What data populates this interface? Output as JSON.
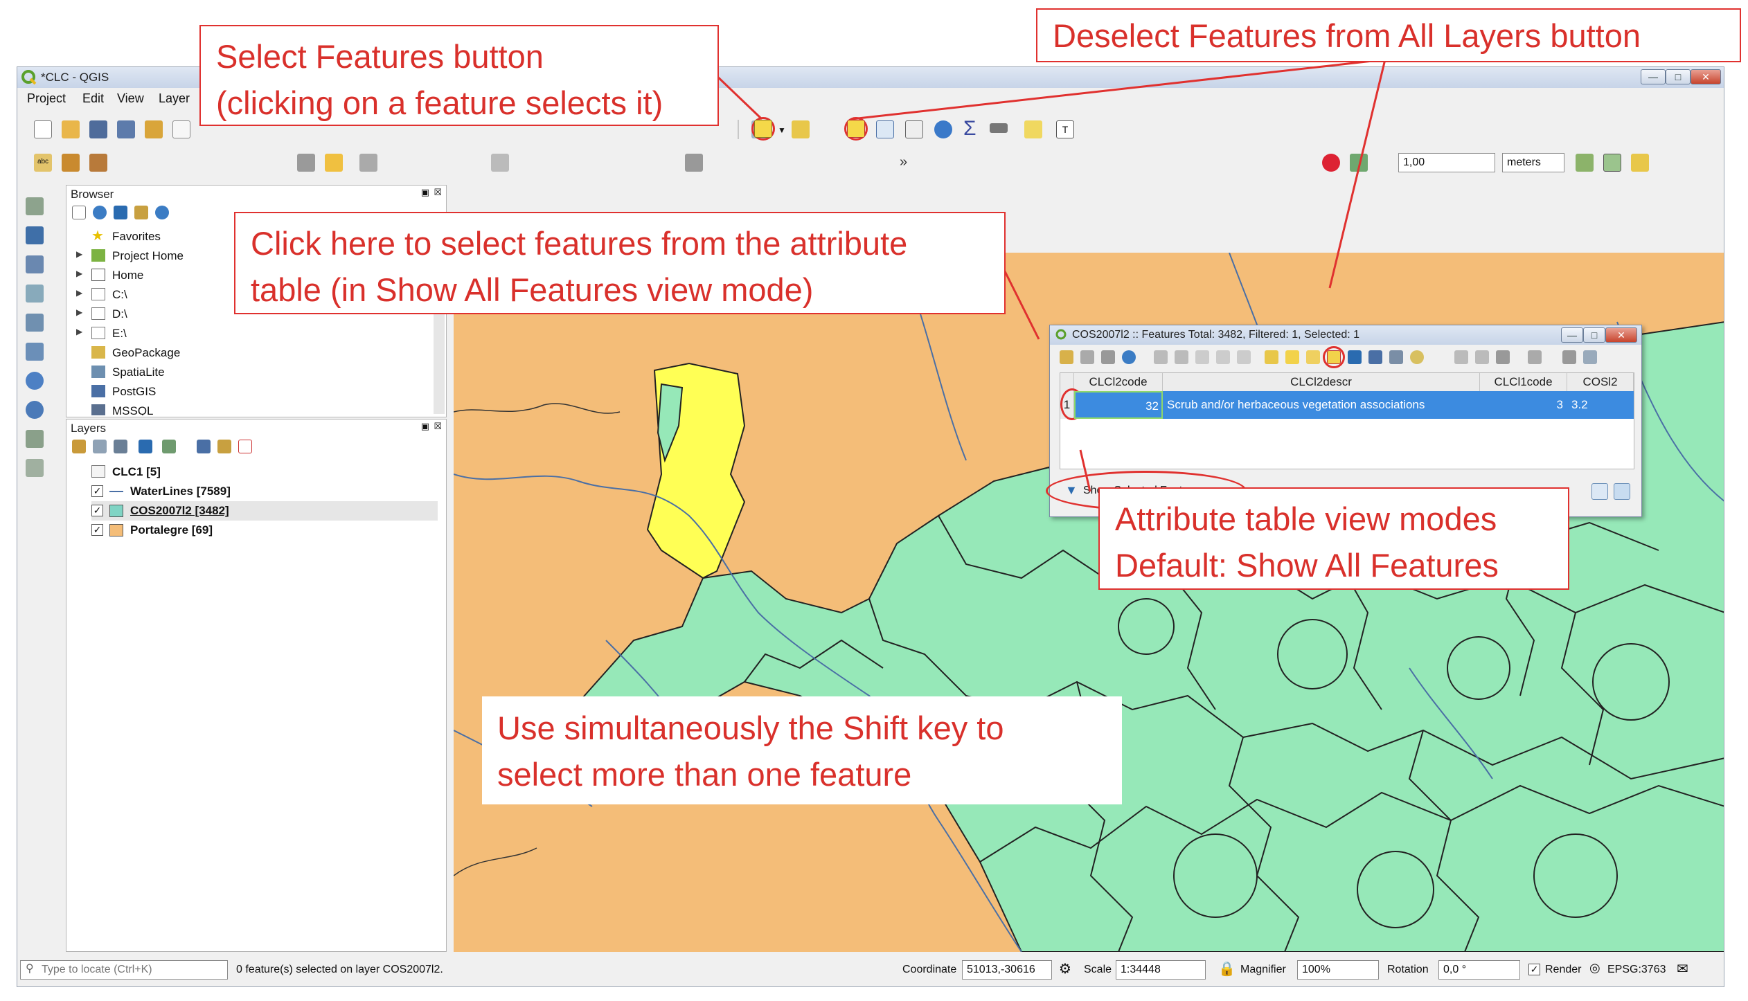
{
  "window": {
    "title": "*CLC - QGIS"
  },
  "menu": [
    "Project",
    "Edit",
    "View",
    "Layer"
  ],
  "toolbar": {
    "scale_value": "1,00",
    "units": "meters"
  },
  "browser": {
    "title": "Browser",
    "items": [
      "Favorites",
      "Project Home",
      "Home",
      "C:\\",
      "D:\\",
      "E:\\",
      "GeoPackage",
      "SpatiaLite",
      "PostGIS",
      "MSSQL"
    ]
  },
  "layers": {
    "title": "Layers",
    "items": [
      "CLC1 [5]",
      "WaterLines [7589]",
      "COS2007l2 [3482]",
      "Portalegre [69]"
    ],
    "colors": {
      "waterlines": "#4a6fa5",
      "cos": "#7fd4c4",
      "portalegre": "#f4bd78"
    }
  },
  "attribute_table": {
    "title": "COS2007l2 :: Features Total: 3482, Filtered: 1, Selected: 1",
    "columns": [
      "CLCl2code",
      "CLCl2descr",
      "CLCl1code",
      "COSl2"
    ],
    "rows": [
      {
        "row_num": "1",
        "CLCl2code": "32",
        "CLCl2descr": "Scrub and/or herbaceous vegetation associations",
        "CLCl1code": "3",
        "COSl2": "3.2"
      }
    ],
    "view_mode": "Show Selected Features"
  },
  "status": {
    "locate_placeholder": "Type to locate (Ctrl+K)",
    "message": "0 feature(s) selected on layer COS2007l2.",
    "coordinate_label": "Coordinate",
    "coordinate_value": "51013,-30616",
    "scale_label": "Scale",
    "scale_value": "1:34448",
    "magnifier_label": "Magnifier",
    "magnifier_value": "100%",
    "rotation_label": "Rotation",
    "rotation_value": "0,0 °",
    "render_label": "Render",
    "crs": "EPSG:3763"
  },
  "callouts": {
    "select_features": [
      "Select Features button",
      "(clicking on a feature selects it)"
    ],
    "deselect": "Deselect Features from All Layers button",
    "attribute_select": [
      "Click here to select features from the attribute",
      "table (in Show All Features view mode)"
    ],
    "view_modes": [
      "Attribute table view modes",
      "Default: Show All Features"
    ],
    "shift": [
      "Use simultaneously the Shift key to",
      "select more than one feature"
    ]
  },
  "colors": {
    "callout_red": "#d9302b",
    "selection_yellow": "#ffff55",
    "vegetation_green": "#96e8b8",
    "land_orange": "#f4bd78",
    "table_selection": "#3c8be0"
  }
}
